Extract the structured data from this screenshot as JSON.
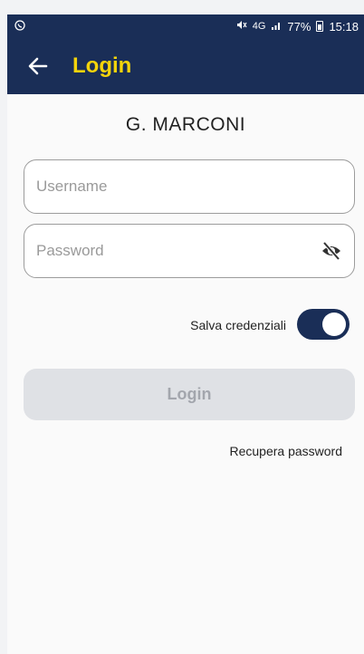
{
  "status_bar": {
    "left_icon": "whatsapp-icon",
    "network": "4G",
    "battery": "77%",
    "time": "15:18"
  },
  "app_bar": {
    "title": "Login",
    "back_icon": "arrow-back-icon",
    "colors": {
      "background": "#1a2e57",
      "title": "#f4d40b"
    }
  },
  "school": {
    "name": "G. MARCONI"
  },
  "form": {
    "username_placeholder": "Username",
    "password_placeholder": "Password",
    "visibility_icon": "eye-off-icon",
    "save_credentials_label": "Salva credenziali",
    "save_credentials_on": true,
    "login_label": "Login",
    "recover_label": "Recupera password"
  }
}
